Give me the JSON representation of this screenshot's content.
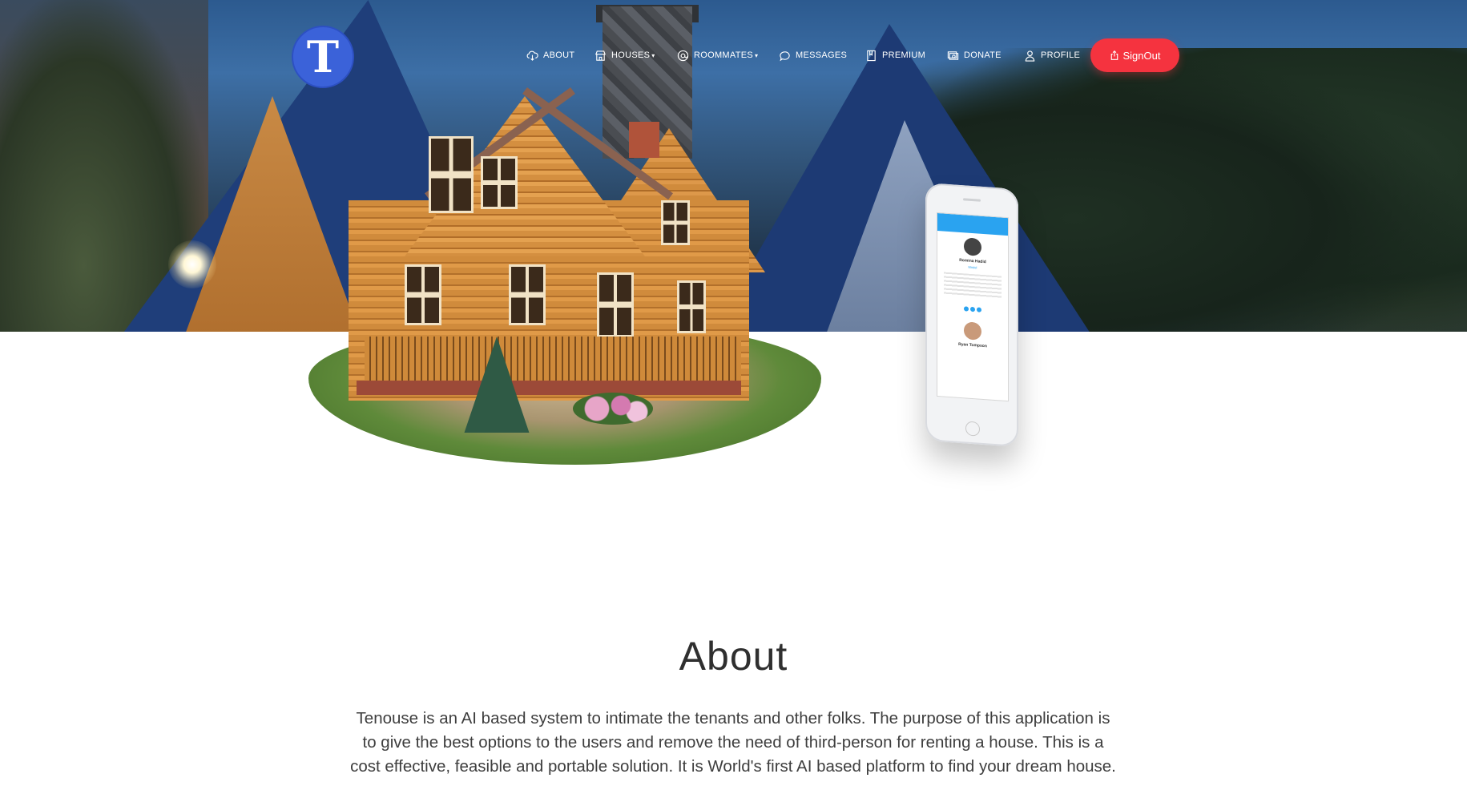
{
  "logo": {
    "letter": "T"
  },
  "nav": {
    "items": [
      {
        "label": "ABOUT",
        "icon": "cloud-download-icon",
        "dropdown": false
      },
      {
        "label": "HOUSES",
        "icon": "store-icon",
        "dropdown": true
      },
      {
        "label": "ROOMMATES",
        "icon": "at-sign-icon",
        "dropdown": true
      },
      {
        "label": "MESSAGES",
        "icon": "chat-bubble-icon",
        "dropdown": false
      },
      {
        "label": "PREMIUM",
        "icon": "bookmark-icon",
        "dropdown": false
      },
      {
        "label": "DONATE",
        "icon": "money-icon",
        "dropdown": false
      },
      {
        "label": "PROFILE",
        "icon": "user-icon",
        "dropdown": false
      }
    ],
    "signout_label": "SignOut",
    "signout_icon": "share-icon",
    "signout_color": "#f5333f"
  },
  "phone": {
    "profile_name": "Romina Hadid",
    "profile_role": "Model",
    "second_name": "Ryan Tompson"
  },
  "about": {
    "title": "About",
    "line1": "Tenouse is an AI based system to intimate the tenants and other folks. The purpose of this application is",
    "line2": "to give the best options to the users and remove the need of third-person for renting a house. This is a",
    "line3": "cost effective, feasible and portable solution. It is World's first AI based platform to find your dream house."
  },
  "colors": {
    "accent": "#3b62d9",
    "hero_sky": "#2c5a8f"
  }
}
